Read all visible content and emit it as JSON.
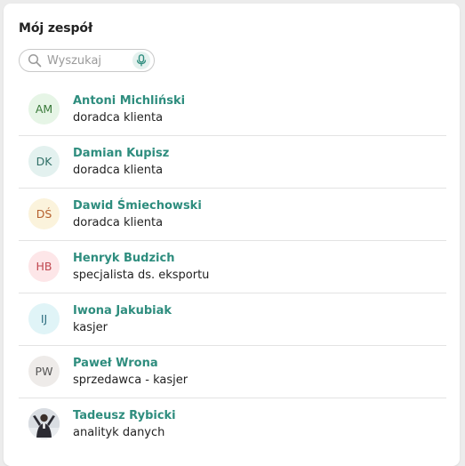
{
  "panel": {
    "title": "Mój zespół"
  },
  "search": {
    "placeholder": "Wyszukaj",
    "value": ""
  },
  "colors": {
    "accent": "#2e8d7e",
    "mic_bg": "#e4f1ee"
  },
  "team": [
    {
      "initials": "AM",
      "name": "Antoni Michliński",
      "role": "doradca klienta",
      "avatar_bg": "#e6f5e6",
      "avatar_fg": "#3a7a3a"
    },
    {
      "initials": "DK",
      "name": "Damian Kupisz",
      "role": "doradca klienta",
      "avatar_bg": "#e3f1ef",
      "avatar_fg": "#2f6f66"
    },
    {
      "initials": "DŚ",
      "name": "Dawid Śmiechowski",
      "role": "doradca klienta",
      "avatar_bg": "#fbf3dc",
      "avatar_fg": "#b5602e"
    },
    {
      "initials": "HB",
      "name": "Henryk Budzich",
      "role": "specjalista ds. eksportu",
      "avatar_bg": "#fde6e8",
      "avatar_fg": "#c0474f"
    },
    {
      "initials": "IJ",
      "name": "Iwona Jakubiak",
      "role": "kasjer",
      "avatar_bg": "#e0f4f7",
      "avatar_fg": "#2f6f80"
    },
    {
      "initials": "PW",
      "name": "Paweł Wrona",
      "role": "sprzedawca - kasjer",
      "avatar_bg": "#eeebe9",
      "avatar_fg": "#555555"
    },
    {
      "initials": "",
      "name": "Tadeusz Rybicki",
      "role": "analityk danych",
      "avatar_photo": true
    }
  ]
}
